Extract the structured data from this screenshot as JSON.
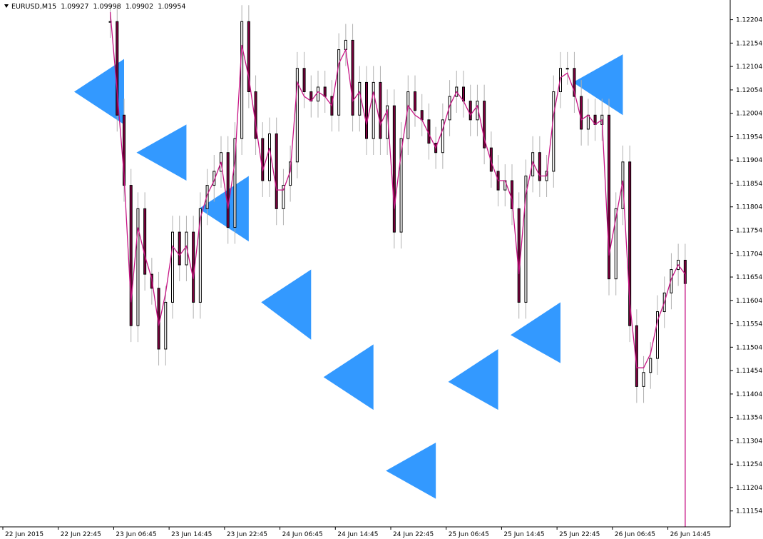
{
  "header": {
    "symbol": "EURUSD,M15",
    "open": "1.09927",
    "high": "1.09998",
    "low": "1.09902",
    "close": "1.09954"
  },
  "colors": {
    "background": "#ffffff",
    "triangles": "#3399ff",
    "candle_body": "#000000",
    "candle_bear_fill": "#800040",
    "line_series": "#c71585",
    "wick": "#b0b0b0",
    "axis": "#000000"
  },
  "chart_data": {
    "type": "line",
    "title": "",
    "xlabel": "",
    "ylabel": "",
    "ylim": [
      1.1112,
      1.1224
    ],
    "y_ticks": [
      "1.12204",
      "1.12154",
      "1.12104",
      "1.12054",
      "1.12004",
      "1.11954",
      "1.11904",
      "1.11854",
      "1.11804",
      "1.11754",
      "1.11704",
      "1.11654",
      "1.11604",
      "1.11554",
      "1.11504",
      "1.11454",
      "1.11404",
      "1.11354",
      "1.11304",
      "1.11254",
      "1.11204",
      "1.11154"
    ],
    "x_ticks": [
      "22 Jun 2015",
      "22 Jun 22:45",
      "23 Jun 06:45",
      "23 Jun 14:45",
      "23 Jun 22:45",
      "24 Jun 06:45",
      "24 Jun 14:45",
      "24 Jun 22:45",
      "25 Jun 06:45",
      "25 Jun 14:45",
      "25 Jun 22:45",
      "26 Jun 06:45",
      "26 Jun 14:45"
    ],
    "x_tick_bars": [
      0,
      32,
      64,
      96,
      128,
      160,
      192,
      224,
      256,
      288,
      320,
      352,
      384
    ],
    "bars_visible": 420,
    "series": [
      {
        "kind": "candlestick",
        "bar": [
          62,
          66,
          70,
          74,
          78,
          82,
          86,
          90,
          94,
          98,
          102,
          106,
          110,
          114,
          118,
          122,
          126,
          130,
          134,
          138,
          142,
          146,
          150,
          154,
          158,
          162,
          166,
          170,
          174,
          178,
          182,
          186,
          190,
          194,
          198,
          202,
          206,
          210,
          214,
          218,
          222,
          226,
          230,
          234,
          238,
          242,
          246,
          250,
          254,
          258,
          262,
          266,
          270,
          274,
          278,
          282,
          286,
          290,
          294,
          298,
          302,
          306,
          310,
          314,
          318,
          322,
          326,
          330,
          334,
          338,
          342,
          346,
          350,
          354,
          358,
          362,
          366,
          370,
          374,
          378,
          382,
          386,
          390,
          394
        ],
        "close": [
          1.122,
          1.12,
          1.1185,
          1.1155,
          1.118,
          1.1166,
          1.1163,
          1.115,
          1.116,
          1.1175,
          1.1168,
          1.1175,
          1.116,
          1.118,
          1.1185,
          1.1188,
          1.1192,
          1.1176,
          1.1195,
          1.122,
          1.1205,
          1.1195,
          1.1186,
          1.1196,
          1.118,
          1.1185,
          1.119,
          1.121,
          1.1205,
          1.1203,
          1.1206,
          1.1204,
          1.12,
          1.1214,
          1.1216,
          1.12,
          1.1207,
          1.1195,
          1.1207,
          1.1195,
          1.1202,
          1.1175,
          1.1195,
          1.1205,
          1.1201,
          1.1199,
          1.1194,
          1.1192,
          1.1199,
          1.1204,
          1.1206,
          1.1203,
          1.1199,
          1.1203,
          1.1193,
          1.1188,
          1.1184,
          1.1186,
          1.118,
          1.116,
          1.1187,
          1.1192,
          1.1186,
          1.1188,
          1.1205,
          1.121,
          1.121,
          1.1204,
          1.1197,
          1.12,
          1.1198,
          1.12,
          1.1165,
          1.118,
          1.119,
          1.1155,
          1.1142,
          1.1145,
          1.1148,
          1.1158,
          1.1162,
          1.1167,
          1.1169,
          1.1164
        ]
      },
      {
        "kind": "line",
        "name": "",
        "bar": [
          62,
          66,
          70,
          74,
          78,
          82,
          86,
          90,
          94,
          98,
          102,
          106,
          110,
          114,
          118,
          122,
          126,
          130,
          134,
          138,
          142,
          146,
          150,
          154,
          158,
          162,
          166,
          170,
          174,
          178,
          182,
          186,
          190,
          194,
          198,
          202,
          206,
          210,
          214,
          218,
          222,
          226,
          230,
          234,
          238,
          242,
          246,
          250,
          254,
          258,
          262,
          266,
          270,
          274,
          278,
          282,
          286,
          290,
          294,
          298,
          302,
          306,
          310,
          314,
          318,
          322,
          326,
          330,
          334,
          338,
          342,
          346,
          350,
          354,
          358,
          362,
          366,
          370,
          374,
          378,
          382,
          386,
          390,
          394,
          394
        ],
        "value": [
          1.1222,
          1.1205,
          1.1187,
          1.116,
          1.1176,
          1.117,
          1.1165,
          1.1155,
          1.1162,
          1.1172,
          1.117,
          1.1172,
          1.1165,
          1.1178,
          1.1183,
          1.1186,
          1.119,
          1.118,
          1.119,
          1.1215,
          1.1208,
          1.1198,
          1.1188,
          1.1193,
          1.1184,
          1.1184,
          1.1188,
          1.1207,
          1.1204,
          1.1203,
          1.1205,
          1.1204,
          1.1202,
          1.1211,
          1.1214,
          1.1203,
          1.1205,
          1.1198,
          1.1205,
          1.1198,
          1.1201,
          1.118,
          1.1192,
          1.1202,
          1.12,
          1.1199,
          1.1196,
          1.1193,
          1.1197,
          1.1202,
          1.1205,
          1.1203,
          1.12,
          1.1202,
          1.1195,
          1.119,
          1.1186,
          1.1186,
          1.1182,
          1.1166,
          1.1183,
          1.119,
          1.1187,
          1.1187,
          1.12,
          1.1208,
          1.1209,
          1.1205,
          1.1199,
          1.12,
          1.1198,
          1.1199,
          1.117,
          1.1178,
          1.1186,
          1.116,
          1.1146,
          1.1146,
          1.1149,
          1.1156,
          1.116,
          1.1165,
          1.1168,
          1.1166,
          1.1112
        ]
      }
    ],
    "triangle_overlay": {
      "color": "#3399ff",
      "up": [
        [
          1.1198,
          1.1212,
          1.1205
        ],
        [
          1.1198,
          1.1186,
          1.1192
        ],
        [
          1.1187,
          1.1173,
          1.118
        ],
        [
          1.1167,
          1.1152,
          1.116
        ],
        [
          1.1151,
          1.1137,
          1.1144
        ],
        [
          1.113,
          1.1118,
          1.1124
        ],
        [
          1.115,
          1.1137,
          1.1143
        ],
        [
          1.116,
          1.1147,
          1.1153
        ],
        [
          1.1213,
          1.12,
          1.1207
        ]
      ]
    }
  }
}
